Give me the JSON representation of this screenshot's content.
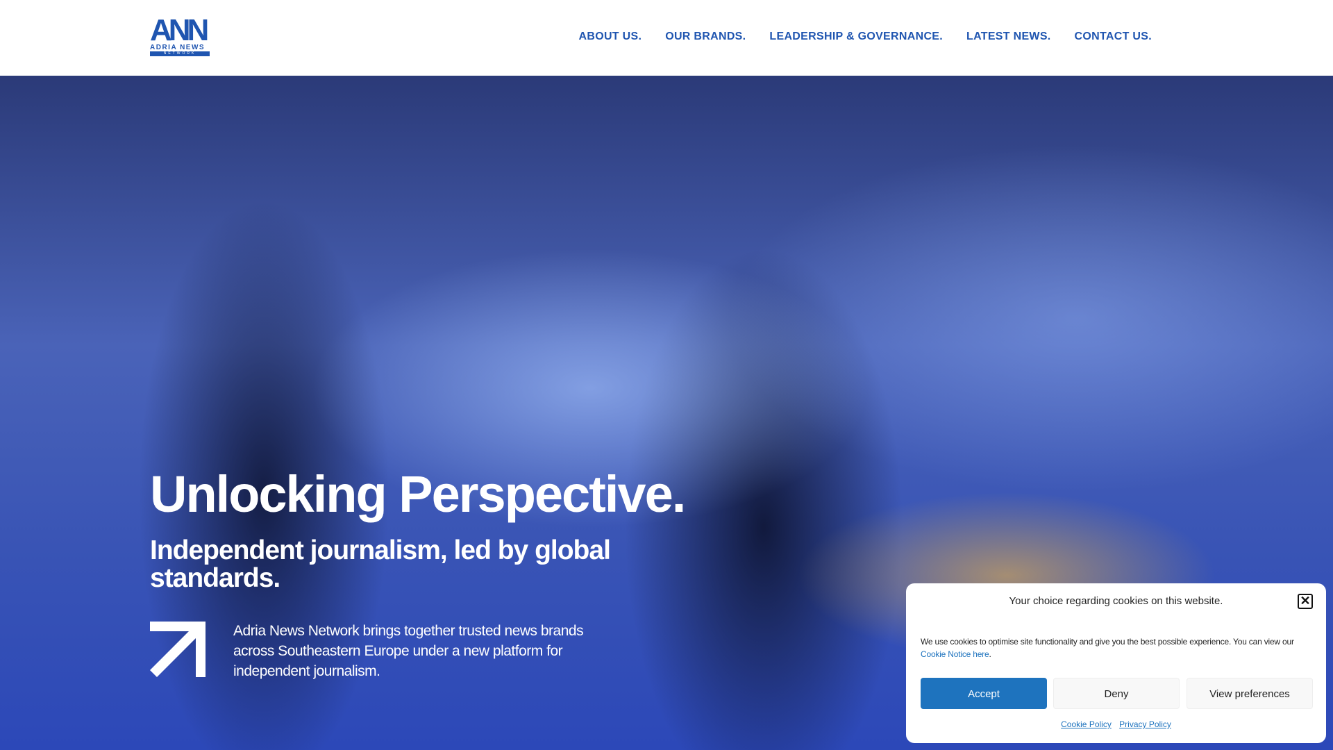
{
  "logo": {
    "big": "ANN",
    "sub": "ADRIA NEWS",
    "net": "NETWORK"
  },
  "nav": [
    "ABOUT US.",
    "OUR BRANDS.",
    "LEADERSHIP & GOVERNANCE.",
    "LATEST NEWS.",
    "CONTACT US."
  ],
  "hero": {
    "title": "Unlocking Perspective.",
    "subtitle": "Independent journalism, led by global standards.",
    "body": "Adria News Network brings together trusted news brands across Southeastern Europe under a new platform for independent journalism."
  },
  "cookie": {
    "title": "Your choice regarding cookies on this website.",
    "close": "✕",
    "body": "We use cookies to optimise site functionality and give you the best possible experience. You can view our ",
    "notice_link": "Cookie Notice here",
    "period": ".",
    "accept": "Accept",
    "deny": "Deny",
    "prefs": "View preferences",
    "cookie_policy": "Cookie Policy",
    "privacy_policy": "Privacy Policy"
  }
}
